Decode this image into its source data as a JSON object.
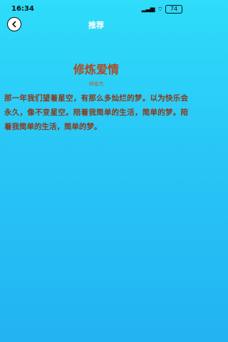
{
  "status_bar": {
    "time": "16:34",
    "signal": "all",
    "wifi": "wifi",
    "battery": "74"
  },
  "header": {
    "title": "推荐",
    "back_icon": "chevron-left-icon"
  },
  "article": {
    "title": "修炼爱情",
    "author": "林俊杰",
    "body": "那一年我们望着星空，有那么多灿烂的梦。以为快乐会永久，像不变星空。陪着我简单的生活，简单的梦。陪着我简单的生活，简单的梦。"
  },
  "colors": {
    "background_top": "#2fdcfa",
    "background_bottom": "#22b3f2",
    "title": "#b04a22",
    "body": "#8a3a1c"
  }
}
